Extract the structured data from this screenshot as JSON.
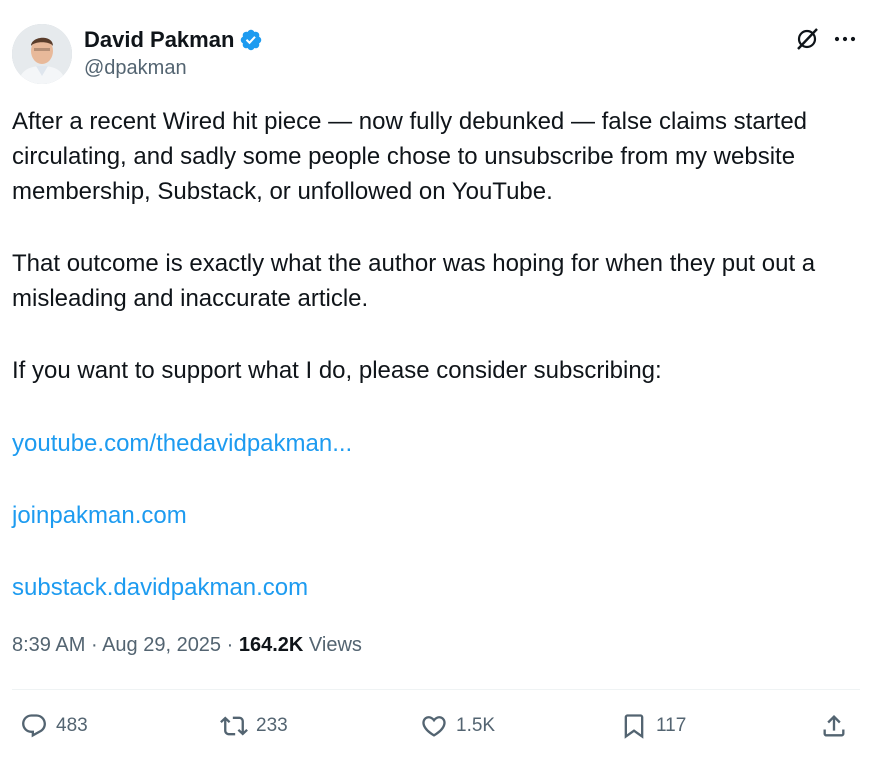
{
  "post": {
    "author": {
      "name": "David Pakman",
      "handle": "@dpakman"
    },
    "text": {
      "paragraph_1": "After a recent Wired hit piece — now fully debunked — false claims started circulating, and sadly some people chose to unsubscribe from my website membership, Substack, or unfollowed on YouTube.",
      "paragraph_2": "That outcome is exactly what the author was hoping for when they put out a misleading and inaccurate article.",
      "paragraph_3": "If you want to support what I do, please consider subscribing:"
    },
    "links": {
      "youtube": "youtube.com/thedavidpakman...",
      "joinpakman": "joinpakman.com",
      "substack": "substack.davidpakman.com"
    },
    "meta": {
      "time": "8:39 AM",
      "separator": " · ",
      "date": "Aug 29, 2025",
      "views_count": "164.2K",
      "views_label": " Views"
    },
    "actions": {
      "replies": "483",
      "reposts": "233",
      "likes": "1.5K",
      "bookmarks": "117"
    }
  },
  "icons": {
    "verified": "verified-badge-icon",
    "grok": "grok-icon",
    "more": "more-icon",
    "reply": "reply-icon",
    "repost": "repost-icon",
    "like": "like-icon",
    "bookmark": "bookmark-icon",
    "share": "share-icon"
  },
  "colors": {
    "link": "#1d9bf0",
    "verified": "#1d9bf0",
    "secondary_text": "#536471",
    "primary_text": "#0f1419"
  }
}
